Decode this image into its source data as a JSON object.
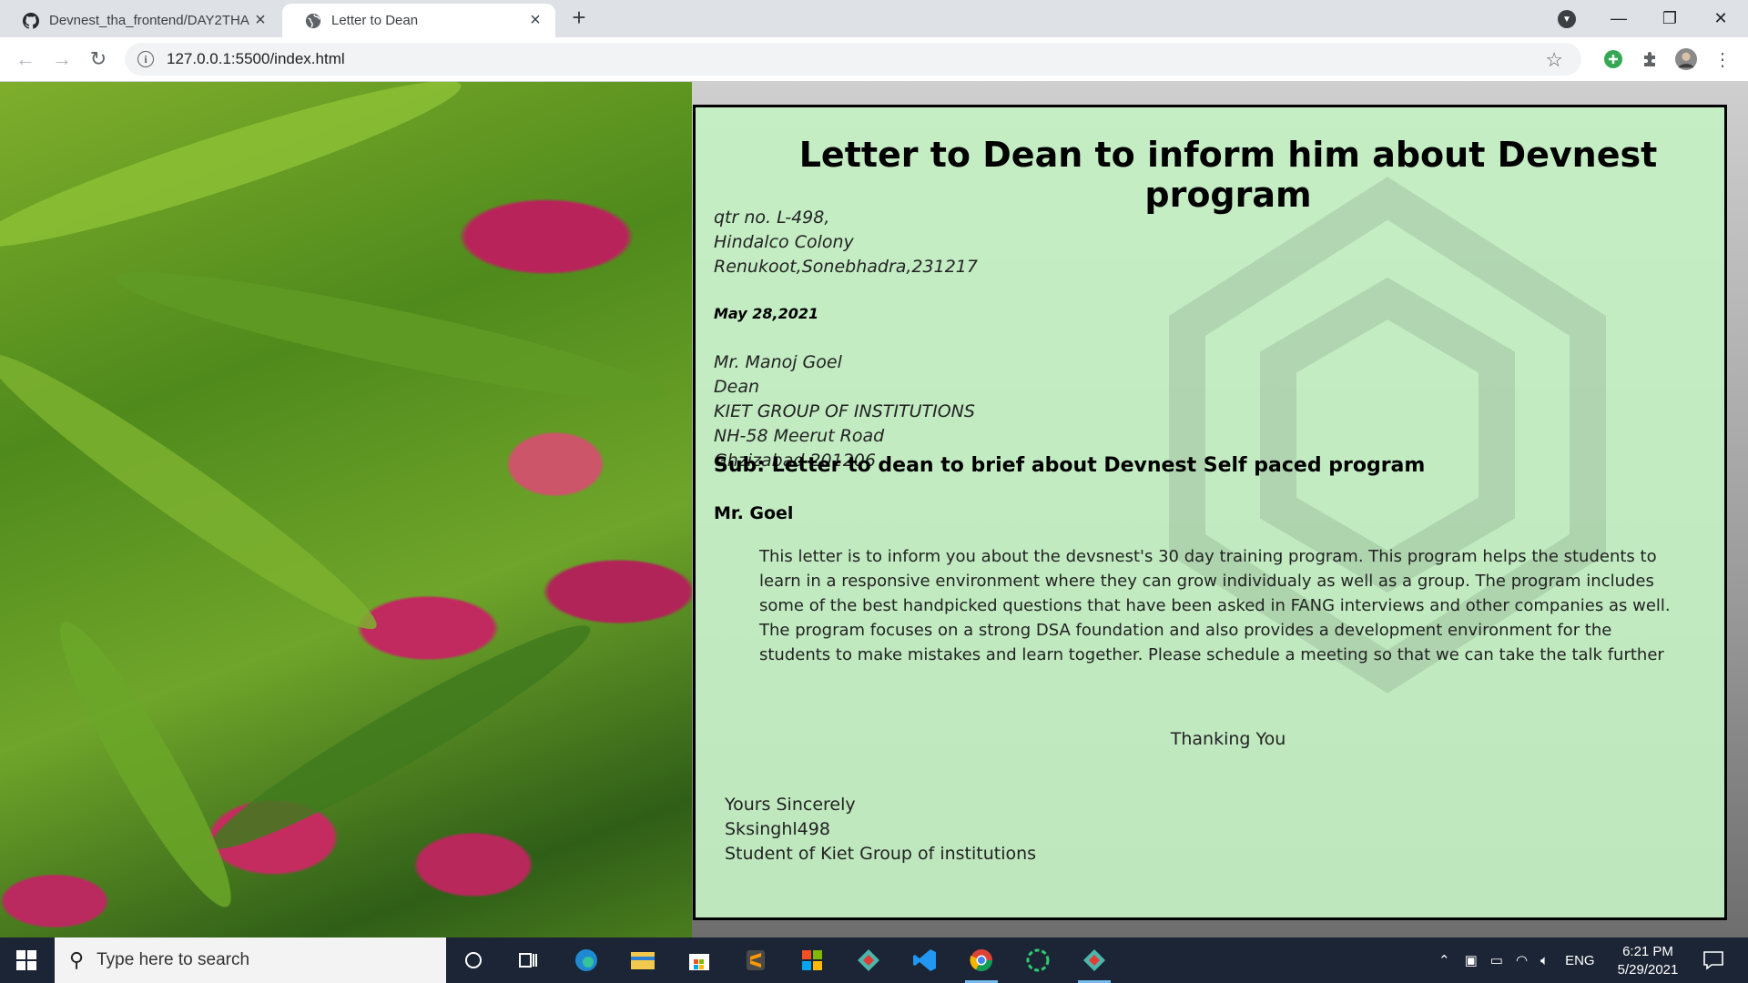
{
  "browser": {
    "tabs": [
      {
        "title": "Devnest_tha_frontend/DAY2THA",
        "favicon": "github-icon",
        "active": false
      },
      {
        "title": "Letter to Dean",
        "favicon": "globe-icon",
        "active": true
      }
    ],
    "url": "127.0.0.1:5500/index.html"
  },
  "letter": {
    "title": "Letter to Dean to inform him about Devnest program",
    "sender_address": [
      "qtr no. L-498,",
      "Hindalco Colony",
      "Renukoot,Sonebhadra,231217"
    ],
    "date": "May 28,2021",
    "recipient": [
      "Mr. Manoj Goel",
      "Dean",
      "KIET GROUP OF INSTITUTIONS",
      "NH-58 Meerut Road",
      "Ghzizabad 201206"
    ],
    "subject": "Sub: Letter to dean to brief about Devnest Self paced program",
    "salutation": "Mr. Goel",
    "body": "This letter is to inform you about the devsnest's 30 day training program. This program helps the students to learn in a responsive environment where they can grow individualy as well as a group. The program includes some of the best handpicked questions that have been asked in FANG interviews and other companies as well. The program focuses on a strong DSA foundation and also provides a development environment for the students to make mistakes and learn together. Please schedule a meeting so that we can take the talk further",
    "thanks": "Thanking You",
    "closing": [
      "Yours Sincerely",
      "Sksinghl498",
      "Student of Kiet Group of institutions"
    ]
  },
  "taskbar": {
    "search_placeholder": "Type here to search",
    "language": "ENG",
    "time": "6:21 PM",
    "date": "5/29/2021"
  }
}
